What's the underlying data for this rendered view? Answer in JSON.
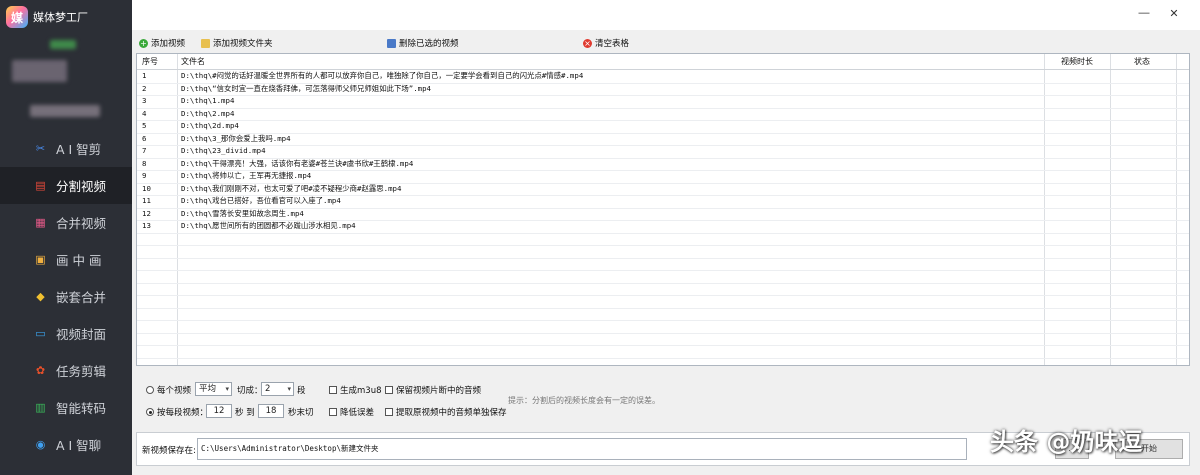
{
  "app": {
    "title": "媒体梦工厂",
    "logo_char": "媒"
  },
  "sidebar": {
    "items": [
      {
        "label": "A I 智剪",
        "icon": "ai-cut-icon",
        "active": false
      },
      {
        "label": "分割视频",
        "icon": "split-video-icon",
        "active": true
      },
      {
        "label": "合并视频",
        "icon": "merge-video-icon",
        "active": false
      },
      {
        "label": "画 中 画",
        "icon": "picture-in-picture-icon",
        "active": false
      },
      {
        "label": "嵌套合并",
        "icon": "nested-merge-icon",
        "active": false
      },
      {
        "label": "视频封面",
        "icon": "video-cover-icon",
        "active": false
      },
      {
        "label": "任务剪辑",
        "icon": "task-edit-icon",
        "active": false
      },
      {
        "label": "智能转码",
        "icon": "smart-transcode-icon",
        "active": false
      },
      {
        "label": "A I 智聊",
        "icon": "ai-chat-icon",
        "active": false
      }
    ]
  },
  "toolbar": {
    "add_video": "添加视频",
    "add_folder": "添加视频文件夹",
    "delete_selected": "删除已选的视频",
    "clear_table": "清空表格"
  },
  "table": {
    "columns": {
      "index": "序号",
      "filename": "文件名",
      "duration": "视频时长",
      "status": "状态"
    },
    "rows": [
      {
        "index": "1",
        "filename": "D:\\thq\\#闷觉的话好温暖全世界所有的人都可以放弃你自己，唯独除了你自己，一定要学会看到自己的闪光点#情感#.mp4"
      },
      {
        "index": "2",
        "filename": "D:\\thq\\“信女时宜一直在烧香拜佛，可怎落得师父师兄师姐如此下场”.mp4"
      },
      {
        "index": "3",
        "filename": "D:\\thq\\1.mp4"
      },
      {
        "index": "4",
        "filename": "D:\\thq\\2.mp4"
      },
      {
        "index": "5",
        "filename": "D:\\thq\\2d.mp4"
      },
      {
        "index": "6",
        "filename": "D:\\thq\\3_那你会爱上我吗.mp4"
      },
      {
        "index": "7",
        "filename": "D:\\thq\\23_divid.mp4"
      },
      {
        "index": "8",
        "filename": "D:\\thq\\干得漂亮！大强，话该你有老婆#苍兰诀#虞书欣#王鹤棣.mp4"
      },
      {
        "index": "9",
        "filename": "D:\\thq\\将帅以亡，王军再无捷报.mp4"
      },
      {
        "index": "10",
        "filename": "D:\\thq\\我们刚刚不对，也太可爱了吧#凌不疑程少商#赵露思.mp4"
      },
      {
        "index": "11",
        "filename": "D:\\thq\\戏台已搭好，吾位看官可以入座了.mp4"
      },
      {
        "index": "12",
        "filename": "D:\\thq\\雪落长安里如故念周生.mp4"
      },
      {
        "index": "13",
        "filename": "D:\\thq\\愿世间所有的团圆都不必跋山涉水相见.mp4"
      }
    ]
  },
  "options": {
    "per_video_label": "每个视频",
    "mode_value": "平均",
    "cut_label": "切成：",
    "segments_value": "2",
    "segments_unit": "段",
    "per_sec_label": "按每段视频：",
    "from_value": "12",
    "sec_to": "秒 到",
    "to_value": "18",
    "sec_end": "秒末切",
    "gen_m3u8": "生成m3u8",
    "keep_audio": "保留视频片断中的音频",
    "reduce_error": "降低误差",
    "extract_audio": "提取原视频中的音频单独保存",
    "tip": "提示：分割后的视频长度会有一定的误差。"
  },
  "save": {
    "label": "新视频保存在:",
    "path": "C:\\Users\\Administrator\\Desktop\\新建文件夹",
    "browse": "…",
    "start": "开始"
  },
  "watermark": "头条 @奶味逗",
  "colors": {
    "sidebar_bg": "#2c2f36",
    "sidebar_active": "#1f2126",
    "add_icon": "#3aa83a",
    "clear_icon": "#e03a2f"
  }
}
